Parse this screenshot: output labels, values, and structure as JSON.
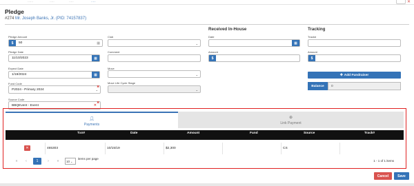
{
  "header": {
    "title": "Pledge",
    "pledge_number": "#274",
    "donor_link": "Mr. Joseph Banks, Jr. (PID: 74157837)"
  },
  "form": {
    "pledge_amount": {
      "label": "Pledge Amount",
      "prefix": "$",
      "value": "50"
    },
    "pledge_date": {
      "label": "Pledge Date",
      "value": "11/10/2023"
    },
    "expect_date": {
      "label": "Expect Date",
      "value": "1/19/2024"
    },
    "fund_code": {
      "label": "Fund Code",
      "value": "P2024 - Primary 2024"
    },
    "source_code": {
      "label": "Source Code",
      "value": "BBQEvent - Event"
    },
    "club": {
      "label": "Club",
      "value": ""
    },
    "comment": {
      "label": "Comment",
      "value": ""
    },
    "move": {
      "label": "Move",
      "value": ""
    },
    "move_life_cycle_stage": {
      "label": "Move Life Cycle Stage",
      "value": ""
    }
  },
  "received_in_house": {
    "heading": "Received In-House",
    "date_label": "Date",
    "amount_label": "Amount",
    "prefix": "$"
  },
  "tracking": {
    "heading": "Tracking",
    "track_label": "Track#",
    "amount_label": "Amount",
    "prefix": "$",
    "add_fundraiser_label": "Add Fundraiser",
    "balance_label": "Balance",
    "balance_value": "0"
  },
  "tabs": {
    "payments": "Payments",
    "link_payment": "Link Payment"
  },
  "table": {
    "columns": [
      "Txn#",
      "Date",
      "Amount",
      "Fund",
      "Source",
      "Track#"
    ],
    "rows": [
      {
        "txn": "465303",
        "date": "10/15/19",
        "amount": "$2,300",
        "fund": "",
        "source": "CS",
        "track": ""
      }
    ]
  },
  "pager": {
    "current_page": "1",
    "page_size": "10",
    "items_per_page_label": "items per page",
    "count_text": "1 - 1 of 1 items"
  },
  "footer": {
    "cancel_label": "Cancel",
    "save_label": "Save"
  },
  "colors": {
    "accent": "#3473b7",
    "danger": "#d9534f",
    "highlight_border": "#e02020"
  }
}
